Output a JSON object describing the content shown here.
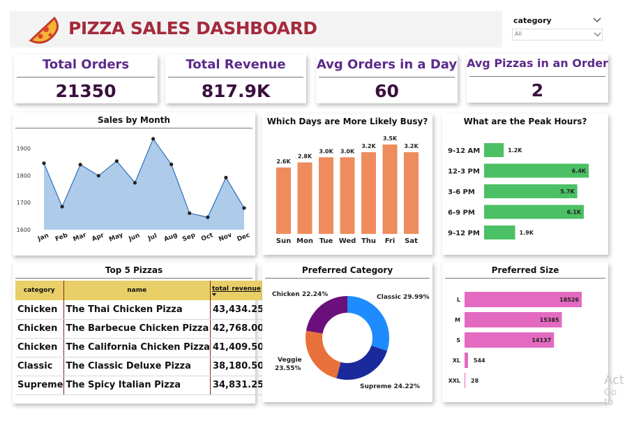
{
  "header": {
    "title": "PIZZA SALES DASHBOARD",
    "logo_icon": "pizza-slice-icon",
    "title_color": "#a52a3c"
  },
  "slicer": {
    "label": "category",
    "value": "All"
  },
  "kpis": [
    {
      "title": "Total Orders",
      "value": "21350"
    },
    {
      "title": "Total Revenue",
      "value": "817.9K"
    },
    {
      "title": "Avg Orders in a Day",
      "value": "60"
    },
    {
      "title": "Avg Pizzas in an Order",
      "value": "2"
    }
  ],
  "colors": {
    "kpi_title": "#5b2a8a",
    "area_fill": "#aecbea",
    "line": "#2f6fba",
    "bar_orange": "#ee8c5e",
    "bar_green": "#4cc064",
    "bar_pink": "#e36ac0",
    "donut": [
      "#1e8bff",
      "#1a2a9c",
      "#e8703a",
      "#6b0f7c"
    ]
  },
  "chart_data": [
    {
      "type": "area",
      "title": "Sales by Month",
      "categories": [
        "Jan",
        "Feb",
        "Mar",
        "Apr",
        "May",
        "Jun",
        "Jul",
        "Aug",
        "Sep",
        "Oct",
        "Nov",
        "Dec"
      ],
      "values": [
        1845,
        1685,
        1840,
        1799,
        1853,
        1773,
        1935,
        1841,
        1661,
        1646,
        1792,
        1680
      ],
      "yticks": [
        1600,
        1700,
        1800,
        1900
      ],
      "ylim": [
        1600,
        1950
      ]
    },
    {
      "type": "bar",
      "title": "Which Days are More Likely Busy?",
      "categories": [
        "Sun",
        "Mon",
        "Tue",
        "Wed",
        "Thu",
        "Fri",
        "Sat"
      ],
      "values": [
        2.6,
        2.8,
        3.0,
        3.0,
        3.2,
        3.5,
        3.2
      ],
      "labels": [
        "2.6K",
        "2.8K",
        "3.0K",
        "3.0K",
        "3.2K",
        "3.5K",
        "3.2K"
      ]
    },
    {
      "type": "bar",
      "orientation": "horizontal",
      "title": "What are the Peak Hours?",
      "categories": [
        "9-12 AM",
        "12-3 PM",
        "3-6 PM",
        "6-9 PM",
        "9-12 PM"
      ],
      "values": [
        1.2,
        6.4,
        5.7,
        6.1,
        1.9
      ],
      "labels": [
        "1.2K",
        "6.4K",
        "5.7K",
        "6.1K",
        "1.9K"
      ]
    },
    {
      "type": "table",
      "title": "Top 5 Pizzas",
      "columns": [
        "category",
        "name",
        "total_revenue"
      ],
      "rows": [
        [
          "Chicken",
          "The Thai Chicken Pizza",
          "43,434.25"
        ],
        [
          "Chicken",
          "The Barbecue Chicken Pizza",
          "42,768.00"
        ],
        [
          "Chicken",
          "The California Chicken Pizza",
          "41,409.50"
        ],
        [
          "Classic",
          "The Classic Deluxe Pizza",
          "38,180.50"
        ],
        [
          "Supreme",
          "The Spicy Italian Pizza",
          "34,831.25"
        ]
      ]
    },
    {
      "type": "pie",
      "title": "Preferred Category",
      "categories": [
        "Classic",
        "Supreme",
        "Veggie",
        "Chicken"
      ],
      "values": [
        29.99,
        24.22,
        23.55,
        22.24
      ],
      "labels": [
        "Classic 29.99%",
        "Supreme 24.22%",
        "Veggie 23.55%",
        "Chicken 22.24%"
      ],
      "veggie_label_lines": [
        "Veggie",
        "23.55%"
      ]
    },
    {
      "type": "bar",
      "orientation": "horizontal",
      "title": "Preferred Size",
      "categories": [
        "L",
        "M",
        "S",
        "XL",
        "XXL"
      ],
      "values": [
        18526,
        15385,
        14137,
        544,
        28
      ],
      "labels": [
        "18526",
        "15385",
        "14137",
        "544",
        "28"
      ]
    }
  ],
  "watermark": {
    "line1": "Act",
    "line2": "Go to"
  }
}
